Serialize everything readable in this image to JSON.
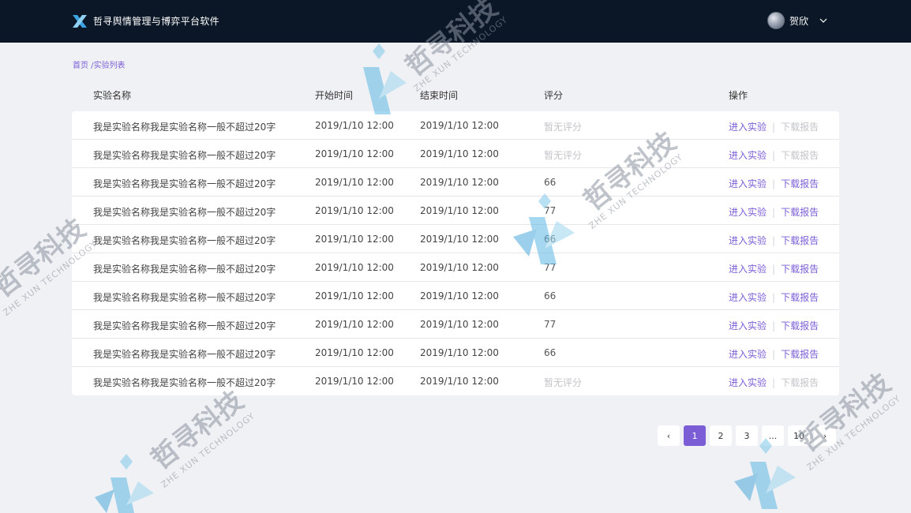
{
  "header": {
    "title": "哲寻舆情管理与博弈平台软件",
    "user_name": "贺欣"
  },
  "breadcrumb": {
    "home": "首页",
    "separator": " /",
    "current": "实验列表"
  },
  "table": {
    "columns": {
      "name": "实验名称",
      "start": "开始时间",
      "end": "结束时间",
      "score": "评分",
      "ops": "操作"
    },
    "rows": [
      {
        "name": "我是实验名称我是实验名称一般不超过20字",
        "start": "2019/1/10 12:00",
        "end": "2019/1/10 12:00",
        "score": "暂无评分",
        "enter": "进入实验",
        "download": "下载报告"
      },
      {
        "name": "我是实验名称我是实验名称一般不超过20字",
        "start": "2019/1/10 12:00",
        "end": "2019/1/10 12:00",
        "score": "暂无评分",
        "enter": "进入实验",
        "download": "下载报告"
      },
      {
        "name": "我是实验名称我是实验名称一般不超过20字",
        "start": "2019/1/10 12:00",
        "end": "2019/1/10 12:00",
        "score": "66",
        "enter": "进入实验",
        "download": "下载报告"
      },
      {
        "name": "我是实验名称我是实验名称一般不超过20字",
        "start": "2019/1/10 12:00",
        "end": "2019/1/10 12:00",
        "score": "77",
        "enter": "进入实验",
        "download": "下载报告"
      },
      {
        "name": "我是实验名称我是实验名称一般不超过20字",
        "start": "2019/1/10 12:00",
        "end": "2019/1/10 12:00",
        "score": "66",
        "enter": "进入实验",
        "download": "下载报告"
      },
      {
        "name": "我是实验名称我是实验名称一般不超过20字",
        "start": "2019/1/10 12:00",
        "end": "2019/1/10 12:00",
        "score": "77",
        "enter": "进入实验",
        "download": "下载报告"
      },
      {
        "name": "我是实验名称我是实验名称一般不超过20字",
        "start": "2019/1/10 12:00",
        "end": "2019/1/10 12:00",
        "score": "66",
        "enter": "进入实验",
        "download": "下载报告"
      },
      {
        "name": "我是实验名称我是实验名称一般不超过20字",
        "start": "2019/1/10 12:00",
        "end": "2019/1/10 12:00",
        "score": "77",
        "enter": "进入实验",
        "download": "下载报告"
      },
      {
        "name": "我是实验名称我是实验名称一般不超过20字",
        "start": "2019/1/10 12:00",
        "end": "2019/1/10 12:00",
        "score": "66",
        "enter": "进入实验",
        "download": "下载报告"
      },
      {
        "name": "我是实验名称我是实验名称一般不超过20字",
        "start": "2019/1/10 12:00",
        "end": "2019/1/10 12:00",
        "score": "暂无评分",
        "enter": "进入实验",
        "download": "下载报告"
      }
    ]
  },
  "pagination": {
    "prev": "‹",
    "pages": [
      "1",
      "2",
      "3",
      "...",
      "10"
    ],
    "next": "›",
    "current": "1"
  },
  "watermark": {
    "text": "哲寻科技",
    "sub": "ZHE XUN TECHNOLOGY"
  },
  "colors": {
    "header_bg": "#0b1726",
    "accent": "#7b5ed6",
    "page_bg": "#f0f1f4",
    "muted": "#c2c4c8"
  }
}
